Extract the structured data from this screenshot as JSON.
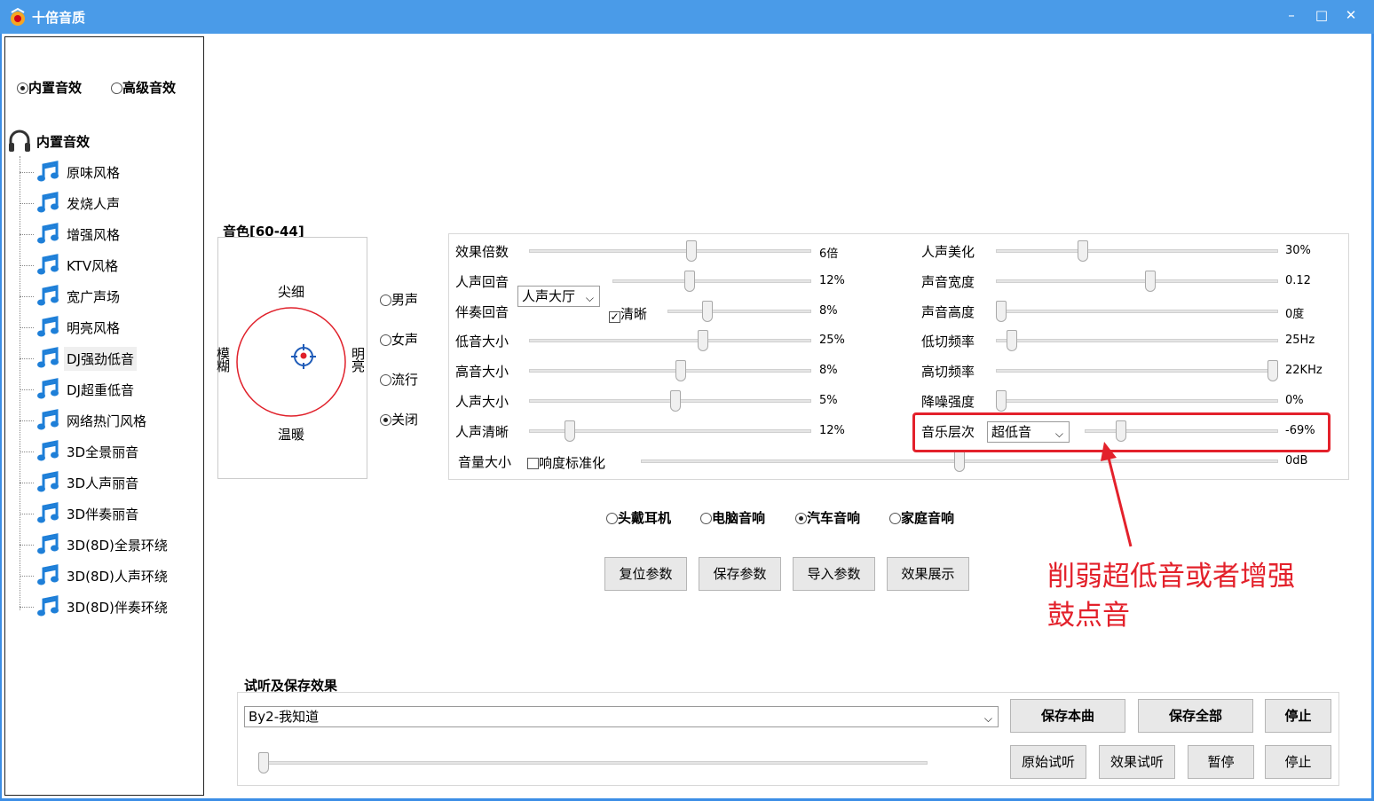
{
  "window": {
    "title": "十倍音质",
    "minimize": "–",
    "maximize": "□",
    "close": "✕"
  },
  "mode": {
    "builtin_label": "内置音效",
    "advanced_label": "高级音效",
    "selected": "builtin"
  },
  "tree": {
    "root_label": "内置音效",
    "items": [
      "原味风格",
      "发烧人声",
      "增强风格",
      "KTV风格",
      "宽广声场",
      "明亮风格",
      "DJ强劲低音",
      "DJ超重低音",
      "网络热门风格",
      "3D全景丽音",
      "3D人声丽音",
      "3D伴奏丽音",
      "3D(8D)全景环绕",
      "3D(8D)人声环绕",
      "3D(8D)伴奏环绕"
    ],
    "selected_index": 6
  },
  "timbre": {
    "title": "音色[60-44]",
    "top": "尖细",
    "bottom": "温暖",
    "left": "模糊",
    "right": "明亮",
    "voice_options": [
      "男声",
      "女声",
      "流行",
      "关闭"
    ],
    "voice_selected": 3
  },
  "params": {
    "effect_multiple": {
      "label": "效果倍数",
      "value": "6倍",
      "level": 0.58
    },
    "vocal_echo": {
      "label": "人声回音",
      "value": "12%",
      "level": 0.38,
      "combo": "人声大厅"
    },
    "accomp_echo": {
      "label": "伴奏回音",
      "value": "8%",
      "level": 0.26,
      "check_label": "清晰",
      "checked": true
    },
    "bass": {
      "label": "低音大小",
      "value": "25%",
      "level": 0.62
    },
    "treble": {
      "label": "高音大小",
      "value": "8%",
      "level": 0.54
    },
    "vocal_volume": {
      "label": "人声大小",
      "value": "5%",
      "level": 0.52
    },
    "vocal_clarity": {
      "label": "人声清晰",
      "value": "12%",
      "level": 0.13
    },
    "volume": {
      "label": "音量大小",
      "value": "0dB",
      "level": 0.5,
      "check_label": "响度标准化",
      "checked": false
    },
    "vocal_beauty": {
      "label": "人声美化",
      "value": "30%",
      "level": 0.3
    },
    "sound_width": {
      "label": "声音宽度",
      "value": "0.12",
      "level": 0.55
    },
    "sound_height": {
      "label": "声音高度",
      "value": "0度",
      "level": 0.0
    },
    "low_cut": {
      "label": "低切频率",
      "value": "25Hz",
      "level": 0.04
    },
    "high_cut": {
      "label": "高切频率",
      "value": "22KHz",
      "level": 1.0
    },
    "noise_reduction": {
      "label": "降噪强度",
      "value": "0%",
      "level": 0.0
    },
    "music_layer": {
      "label": "音乐层次",
      "value": "-69%",
      "level": 0.17,
      "combo": "超低音"
    }
  },
  "output_modes": {
    "options": [
      "头戴耳机",
      "电脑音响",
      "汽车音响",
      "家庭音响"
    ],
    "selected": 2
  },
  "actions": {
    "reset": "复位参数",
    "save": "保存参数",
    "import": "导入参数",
    "demo": "效果展示"
  },
  "annotation": {
    "text": "削弱超低音或者增强鼓点音",
    "color": "#e3212b"
  },
  "preview": {
    "title": "试听及保存效果",
    "song": "By2-我知道",
    "save_song": "保存本曲",
    "save_all": "保存全部",
    "stop1": "停止",
    "original": "原始试听",
    "effect": "效果试听",
    "pause": "暂停",
    "stop2": "停止",
    "progress": 0.0
  },
  "colors": {
    "titlebar": "#4a9be8",
    "accent_red": "#e3212b",
    "note_blue": "#1e7fd8"
  }
}
